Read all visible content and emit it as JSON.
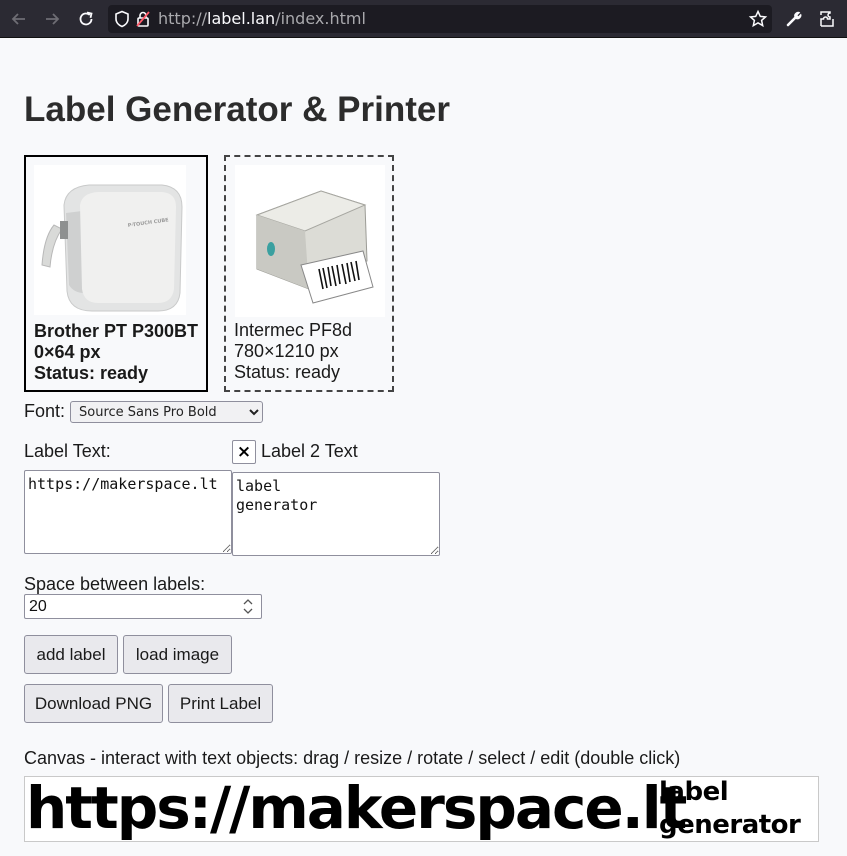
{
  "browser": {
    "url_prefix": "http://",
    "url_host": "label.lan",
    "url_path": "/index.html"
  },
  "page": {
    "title": "Label Generator & Printer"
  },
  "printers": [
    {
      "name": "Brother PT P300BT",
      "size": "0×64 px",
      "status": "Status: ready",
      "selected": true,
      "image": "label-printer-cube-image"
    },
    {
      "name": "Intermec PF8d",
      "size": "780×1210 px",
      "status": "Status: ready",
      "selected": false,
      "image": "barcode-printer-image"
    }
  ],
  "font": {
    "label": "Font:",
    "selected": "Source Sans Pro Bold"
  },
  "label1": {
    "label": "Label Text:",
    "value": "https://makerspace.lt"
  },
  "label2": {
    "checkbox_mark": "×",
    "label": "Label 2 Text",
    "value": "label\ngenerator"
  },
  "spacing": {
    "label": "Space between labels:",
    "value": "20"
  },
  "buttons": {
    "add_label": "add label",
    "load_image": "load image",
    "download_png": "Download PNG",
    "print_label": "Print Label"
  },
  "canvas": {
    "caption": "Canvas - interact with text objects: drag / resize / rotate / select / edit (double click)",
    "text1": "https://makerspace.lt",
    "text2": "label\ngenerator"
  }
}
